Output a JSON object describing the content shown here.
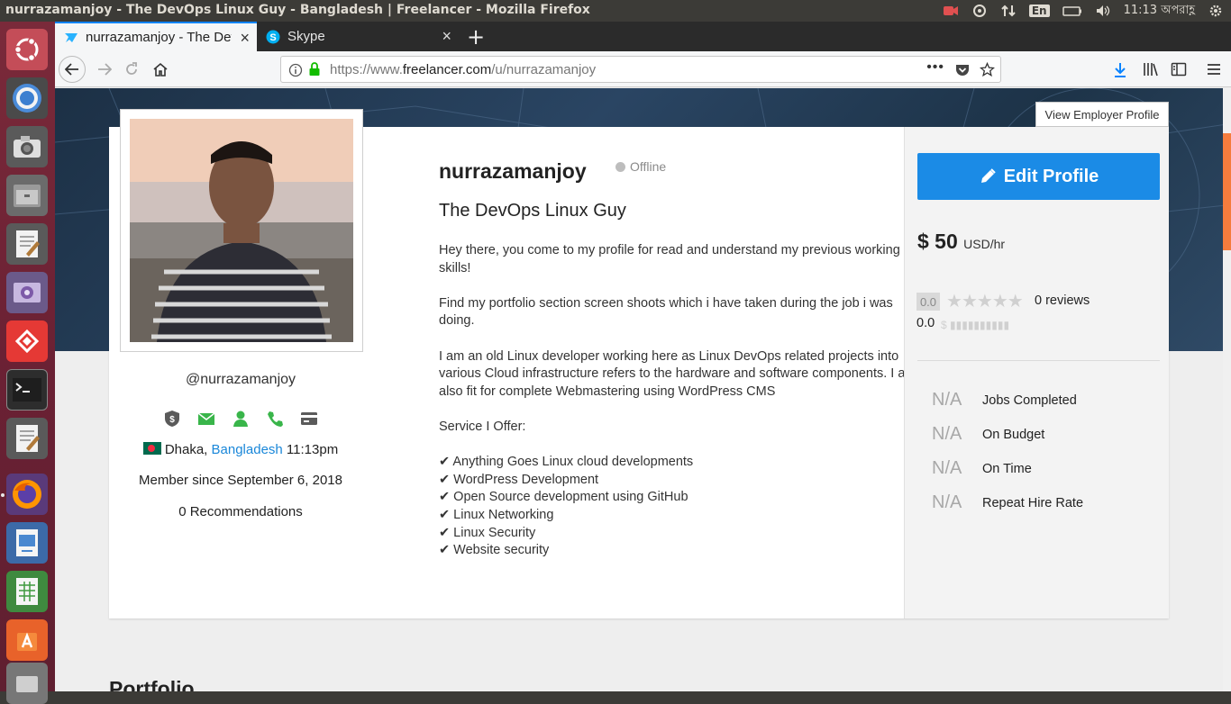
{
  "system": {
    "window_title": "nurrazamanjoy - The DevOps Linux Guy - Bangladesh | Freelancer - Mozilla Firefox",
    "keyboard": "En",
    "clock": "11:13 অপরাহ্ণ"
  },
  "browser": {
    "tabs": [
      {
        "label": "nurrazamanjoy - The DevOps Linux Guy - Bangladesh | Freelancer",
        "active": true
      },
      {
        "label": "Skype",
        "active": false
      }
    ],
    "url_prefix": "https://www.",
    "url_host": "freelancer.com",
    "url_path": "/u/nurrazamanjoy"
  },
  "profile": {
    "view_employer_label": "View Employer Profile",
    "handle": "@nurrazamanjoy",
    "username": "nurrazamanjoy",
    "status": "Offline",
    "tagline": "The DevOps Linux Guy",
    "city": "Dhaka,",
    "country": "Bangladesh",
    "local_time": "11:13pm",
    "member_since": "Member since September 6, 2018",
    "recommendations": "0 Recommendations",
    "description": [
      "Hey there, you come to my profile for read and understand my previous working skills!",
      "Find my portfolio section screen shoots  which i have taken during the job i was doing.",
      "I am an old Linux developer working here as Linux DevOps related projects into various Cloud infrastructure refers to the hardware and software components. I am also fit for complete Webmastering using WordPress CMS",
      "Service I Offer:"
    ],
    "services": [
      "✔ Anything Goes Linux cloud developments",
      "✔ WordPress Development",
      "✔ Open Source development using GitHub",
      "✔ Linux Networking",
      "✔ Linux Security",
      "✔ Website security"
    ]
  },
  "sidebar": {
    "edit_label": "Edit Profile",
    "rate_amount": "$ 50",
    "rate_unit": "USD/hr",
    "score": "0.0",
    "stars_filled": 0,
    "reviews": "0 reviews",
    "earnings_score": "0.0",
    "stats": [
      {
        "value": "N/A",
        "label": "Jobs Completed"
      },
      {
        "value": "N/A",
        "label": "On Budget"
      },
      {
        "value": "N/A",
        "label": "On Time"
      },
      {
        "value": "N/A",
        "label": "Repeat Hire Rate"
      }
    ]
  },
  "sections": {
    "portfolio": "Portfolio"
  },
  "colors": {
    "accent": "#1b8be6",
    "link": "#1a87d9",
    "ubuntu_launcher": "#6b2134"
  }
}
